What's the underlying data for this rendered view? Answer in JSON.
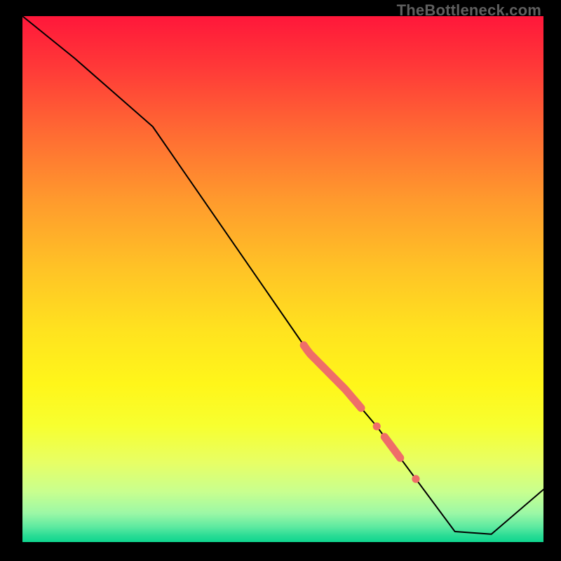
{
  "watermark": "TheBottleneck.com",
  "colors": {
    "background": "#000000",
    "curve": "#000000",
    "highlight": "#ef6d69",
    "gradient_stops": [
      {
        "offset": 0.0,
        "color": "#ff173a"
      },
      {
        "offset": 0.1,
        "color": "#ff3a38"
      },
      {
        "offset": 0.22,
        "color": "#ff6a33"
      },
      {
        "offset": 0.35,
        "color": "#ff9a2d"
      },
      {
        "offset": 0.48,
        "color": "#ffc326"
      },
      {
        "offset": 0.6,
        "color": "#ffe31f"
      },
      {
        "offset": 0.7,
        "color": "#fff61a"
      },
      {
        "offset": 0.78,
        "color": "#f7ff30"
      },
      {
        "offset": 0.85,
        "color": "#e7ff66"
      },
      {
        "offset": 0.905,
        "color": "#c8ff8f"
      },
      {
        "offset": 0.945,
        "color": "#9cf8a6"
      },
      {
        "offset": 0.972,
        "color": "#5be9a0"
      },
      {
        "offset": 0.988,
        "color": "#29dc95"
      },
      {
        "offset": 1.0,
        "color": "#0fd58e"
      }
    ]
  },
  "chart_data": {
    "type": "line",
    "title": "",
    "xlabel": "",
    "ylabel": "",
    "xlim": [
      0,
      100
    ],
    "ylim": [
      0,
      100
    ],
    "x": [
      0,
      10,
      25,
      55,
      62,
      68,
      74,
      77,
      80,
      83,
      90,
      100
    ],
    "values": [
      100,
      92,
      79,
      36,
      29,
      22,
      14,
      10,
      6,
      2,
      1.5,
      10
    ],
    "highlights": [
      {
        "kind": "segment",
        "x0": 54,
        "x1": 65,
        "width": 1.6
      },
      {
        "kind": "dot",
        "x": 68.0,
        "r": 0.75
      },
      {
        "kind": "segment",
        "x0": 69.5,
        "x1": 72.5,
        "width": 1.6
      },
      {
        "kind": "dot",
        "x": 75.5,
        "r": 0.75
      }
    ]
  }
}
